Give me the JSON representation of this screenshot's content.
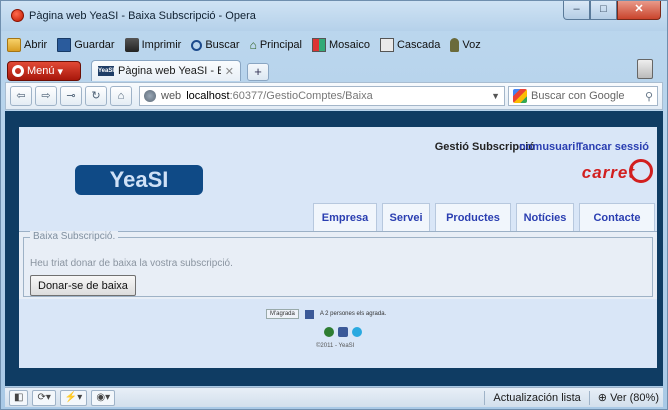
{
  "window": {
    "title": "Pàgina web YeaSI - Baixa Subscripció - Opera",
    "minimize_symbol": "–",
    "maximize_symbol": "□",
    "close_symbol": "✕"
  },
  "bookmarks": [
    {
      "label": "Abrir",
      "icon": "folder-icon"
    },
    {
      "label": "Guardar",
      "icon": "save-icon"
    },
    {
      "label": "Imprimir",
      "icon": "print-icon"
    },
    {
      "label": "Buscar",
      "icon": "search-icon"
    },
    {
      "label": "Principal",
      "icon": "home-icon"
    },
    {
      "label": "Mosaico",
      "icon": "mosaic-icon"
    },
    {
      "label": "Cascada",
      "icon": "cascade-icon"
    },
    {
      "label": "Voz",
      "icon": "microphone-icon"
    }
  ],
  "tabs": {
    "menu_label": "Menú",
    "active_tab": "Pàgina web YeaSI - Bai...",
    "favicon_text": "YeaSI",
    "close_symbol": "✕",
    "new_tab_symbol": "+"
  },
  "address": {
    "back": "⇦",
    "forward": "⇨",
    "key": "⊸",
    "reload": "↻",
    "home": "⌂",
    "label": "web",
    "host": "localhost",
    "path": ":60377/GestioComptes/Baixa",
    "search_placeholder": "Buscar con Google"
  },
  "page": {
    "header": {
      "gestio_label": "Gestió Subscripció",
      "username": "nomusuari!",
      "logout": "Tancar sessió",
      "carret_logo_text": "carret",
      "yeasi_logo_text": "YeaSI"
    },
    "nav": [
      {
        "label": "Empresa",
        "width": 64
      },
      {
        "label": "Servei",
        "width": 48
      },
      {
        "label": "Productes",
        "width": 76
      },
      {
        "label": "Notícies",
        "width": 58
      },
      {
        "label": "Contacte",
        "width": 76
      }
    ],
    "section": {
      "legend": "Baixa Subscripció.",
      "message": "Heu triat donar de baixa la vostra subscripció.",
      "button": "Donar-se de baixa"
    },
    "footer": {
      "like_button": "M'agrada",
      "like_text": "A 2 persones els agrada.",
      "copyright": "©2011 - YeaSI"
    }
  },
  "statusbar": {
    "update_label": "Actualización lista",
    "zoom_label": "Ver (80%)"
  }
}
